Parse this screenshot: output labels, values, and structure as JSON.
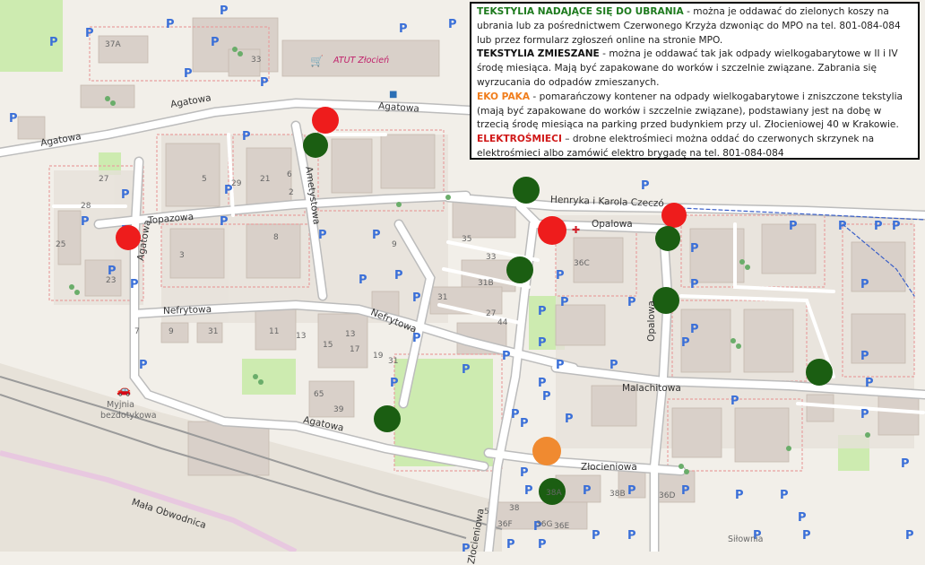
{
  "legend": {
    "blocks": [
      {
        "key": "TEKSTYLIA NADAJĄCE SIĘ DO UBRANIA",
        "key_color": "#1d7a1d",
        "text": " - można je oddawać do zielonych koszy na ubrania lub za pośrednictwem Czerwonego Krzyża dzwoniąc do MPO na tel. 801-084-084 lub przez formularz zgłoszeń online na stronie MPO."
      },
      {
        "key": "TEKSTYLIA ZMIESZANE",
        "key_color": "#111111",
        "text": " - można je oddawać tak jak odpady wielkogabarytowe w II i IV środę miesiąca. Mają być zapakowane do worków i szczelnie związane. Zabrania się wyrzucania do odpadów zmieszanych."
      },
      {
        "key": "EKO PAKA",
        "key_color": "#f07d1c",
        "text": " - pomarańczowy kontener na odpady wielkogabarytowe i zniszczone tekstylia (mają być zapakowane do worków i szczelnie związane), podstawiany jest na dobę w trzecią środę miesiąca na parking przed budynkiem przy ul. Złocieniowej 40 w Krakowie."
      },
      {
        "key": "ELEKTROŚMIECI",
        "key_color": "#d01818",
        "text": "  – drobne elektrośmieci można oddać do czerwonych skrzynek na elektrośmieci albo zamówić elektro brygadę na tel. 801-084-084"
      }
    ]
  },
  "streets": {
    "agatowa_1": "Agatowa",
    "agatowa_2": "Agatowa",
    "agatowa_3": "Agatowa",
    "agatowa_4": "Agatowa",
    "agatowa_5": "Agatowa",
    "topazowa": "Topazowa",
    "ametystowa": "Ametystowa",
    "nefrytowa_1": "Nefrytowa",
    "nefrytowa_2": "Nefrytowa",
    "henryka": "Henryka i Karola Czeczó",
    "opalowa_1": "Opalowa",
    "opalowa_2": "Opalowa",
    "malachitowa": "Malachitowa",
    "zlocieniowa": "Złocieniowa",
    "mala_obwodnica": "Mała Obwodnica",
    "bottom": "Złocieniowa"
  },
  "pois": {
    "atut": "ATUT Złocień",
    "myjnia_1": "Myjnia",
    "myjnia_2": "bezdotykowa",
    "silownia": "Siłownia"
  },
  "house_numbers": [
    "37A",
    "33",
    "27",
    "28",
    "23",
    "25",
    "29",
    "21",
    "6",
    "2",
    "5",
    "8",
    "3",
    "9",
    "13",
    "31",
    "65",
    "39",
    "35",
    "33",
    "31B",
    "31",
    "27",
    "44",
    "36C",
    "38",
    "38A",
    "38B",
    "36D",
    "36F",
    "36G",
    "36E",
    "5",
    "7",
    "9",
    "11",
    "13",
    "15",
    "17",
    "19",
    "31"
  ],
  "parking_label": "P",
  "colors": {
    "red": "#ee1c1c",
    "green": "#1b5e12",
    "orange": "#f08a30",
    "road_outline": "#bcbcbc",
    "building": "#d9d0c9",
    "park": "#cdebb0"
  },
  "markers": [
    {
      "color": "red",
      "name": "marker-red-agatowa"
    },
    {
      "color": "green",
      "name": "marker-green-ametystowa"
    },
    {
      "color": "red",
      "name": "marker-red-topazowa"
    },
    {
      "color": "green",
      "name": "marker-green-henryka"
    },
    {
      "color": "red",
      "name": "marker-red-opalowa-1"
    },
    {
      "color": "red",
      "name": "marker-red-opalowa-2"
    },
    {
      "color": "green",
      "name": "marker-green-opalowa"
    },
    {
      "color": "green",
      "name": "marker-green-35"
    },
    {
      "color": "green",
      "name": "marker-green-opalowa-south"
    },
    {
      "color": "green",
      "name": "marker-green-east"
    },
    {
      "color": "green",
      "name": "marker-green-agatowa-south"
    },
    {
      "color": "orange",
      "name": "marker-orange-zlocieniowa"
    },
    {
      "color": "green",
      "name": "marker-green-zlocieniowa"
    }
  ]
}
